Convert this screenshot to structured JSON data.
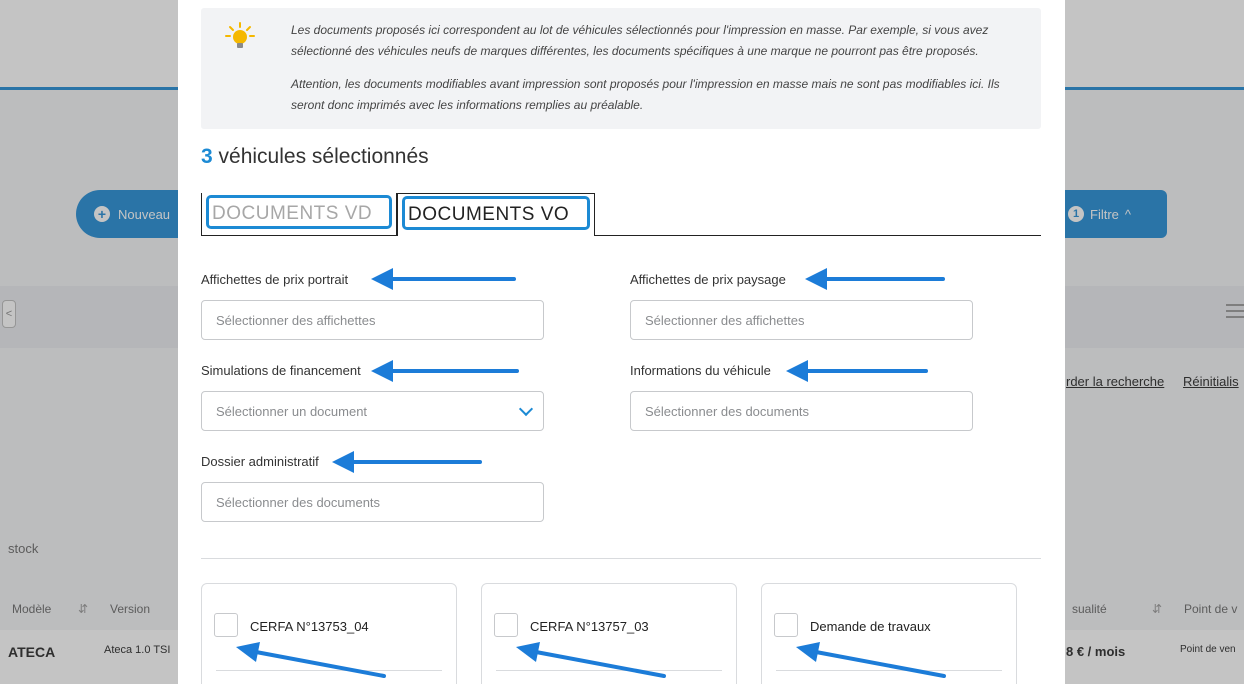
{
  "background": {
    "new_button_label": "Nouveau",
    "filter_count": "1",
    "filter_label": "Filtre",
    "save_search_link": "rder la recherche",
    "reset_link": "Réinitialis",
    "stock_label": "stock",
    "table_headers": {
      "model": "Modèle",
      "version": "Version",
      "actuality": "sualité",
      "point_of_sale": "Point de v"
    },
    "row": {
      "model": "ATECA",
      "version": "Ateca 1.0 TSI",
      "price": "8 € / mois",
      "point_of_sale": "Point de ven"
    }
  },
  "modal": {
    "info": {
      "paragraph_1": "Les documents proposés ici correspondent au lot de véhicules sélectionnés pour l'impression en masse. Par exemple, si vous avez sélectionné des véhicules neufs de marques différentes, les documents spécifiques à une marque ne pourront pas être proposés.",
      "paragraph_2": "Attention, les documents modifiables avant impression sont proposés pour l'impression en masse mais ne sont pas modifiables ici. Ils seront donc imprimés avec les informations remplies au préalable."
    },
    "selection": {
      "count": "3",
      "label": "véhicules sélectionnés"
    },
    "tabs": [
      {
        "label": "DOCUMENTS VD"
      },
      {
        "label": "DOCUMENTS VO"
      }
    ],
    "fields": {
      "portrait": {
        "label": "Affichettes de prix portrait",
        "placeholder": "Sélectionner des affichettes"
      },
      "paysage": {
        "label": "Affichettes de prix paysage",
        "placeholder": "Sélectionner des affichettes"
      },
      "financement": {
        "label": "Simulations de financement",
        "placeholder": "Sélectionner un document"
      },
      "vehicule": {
        "label": "Informations du véhicule",
        "placeholder": "Sélectionner des documents"
      },
      "administratif": {
        "label": "Dossier administratif",
        "placeholder": "Sélectionner des documents"
      }
    },
    "documents": [
      {
        "label": "CERFA N°13753_04"
      },
      {
        "label": "CERFA N°13757_03"
      },
      {
        "label": "Demande de travaux"
      }
    ]
  }
}
